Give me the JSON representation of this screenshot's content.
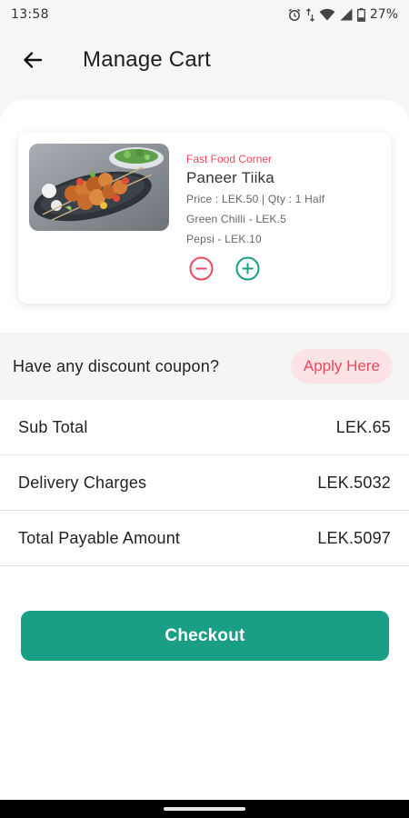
{
  "status_bar": {
    "time": "13:58",
    "battery": "27%",
    "icons": [
      "alarm-icon",
      "wifi-icon",
      "signal-icon",
      "battery-icon"
    ]
  },
  "header": {
    "title": "Manage Cart",
    "back_icon": "arrow-back-icon"
  },
  "cart_item": {
    "restaurant": "Fast Food Corner",
    "name": "Paneer Tiika",
    "price_qty": "Price : LEK.50 | Qty : 1 Half",
    "addons": [
      "Green Chilli - LEK.5",
      "Pepsi - LEK.10"
    ],
    "decrease_icon": "minus-circle-icon",
    "increase_icon": "plus-circle-icon"
  },
  "coupon": {
    "prompt": "Have any discount coupon?",
    "button_label": "Apply Here"
  },
  "summary": [
    {
      "label": "Sub Total",
      "value": "LEK.65"
    },
    {
      "label": "Delivery Charges",
      "value": "LEK.5032"
    },
    {
      "label": "Total Payable Amount",
      "value": "LEK.5097"
    }
  ],
  "checkout": {
    "label": "Checkout"
  },
  "colors": {
    "accent_red": "#e84a5f",
    "accent_teal": "#1a9e85",
    "coupon_bg": "#fbe3e6"
  }
}
